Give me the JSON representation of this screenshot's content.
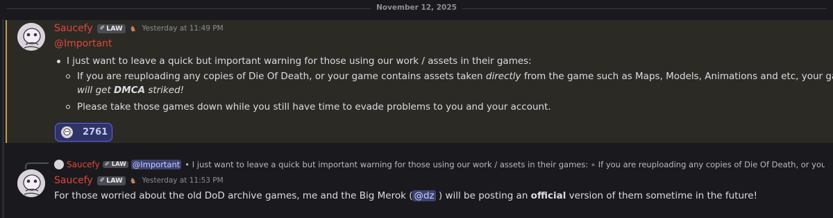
{
  "date_divider": "November 12, 2025",
  "messages": [
    {
      "author": "Saucefy",
      "tag": "LAW",
      "timestamp": "Yesterday at 11:49 PM",
      "mention": "@Important",
      "intro": "I just want to leave a quick but important warning for those using our work / assets in their games:",
      "sub1_a": "If you are reuploading any copies of Die Of Death, or your game contains assets taken ",
      "sub1_em": "directly",
      "sub1_b": " from the game such as Maps, Models, Animations and etc, your game",
      "sub1_c": "will get ",
      "sub1_d": "DMCA",
      "sub1_e": " striked!",
      "sub2": "Please take those games down while you still have time to evade problems to you and your account.",
      "reaction_count": "2761"
    },
    {
      "author": "Saucefy",
      "tag": "LAW",
      "timestamp": "Yesterday at 11:53 PM",
      "reply_author": "Saucefy",
      "reply_tag": "LAW",
      "reply_mention": "@Important",
      "reply_preview": "• I just want to leave a quick but important warning for those using our work / assets in their games: ∘ If you are reuploading any copies of Die Of Death, or your...",
      "text_a": "For those worried about the old DoD archive games, me and the Big Merok (",
      "mention": "@dz",
      "text_b": " ) will be posting an ",
      "text_bold": "official",
      "text_c": " version of them sometime in the future!"
    }
  ],
  "colors": {
    "author": "#e2463c",
    "highlight_bg": "#2b2a25",
    "highlight_border": "#c6a04c",
    "reaction_bg": "#2f3366"
  },
  "icons": [
    "ghost-avatar-icon",
    "law-tag-icon",
    "role-icon",
    "reply-connector-icon"
  ]
}
